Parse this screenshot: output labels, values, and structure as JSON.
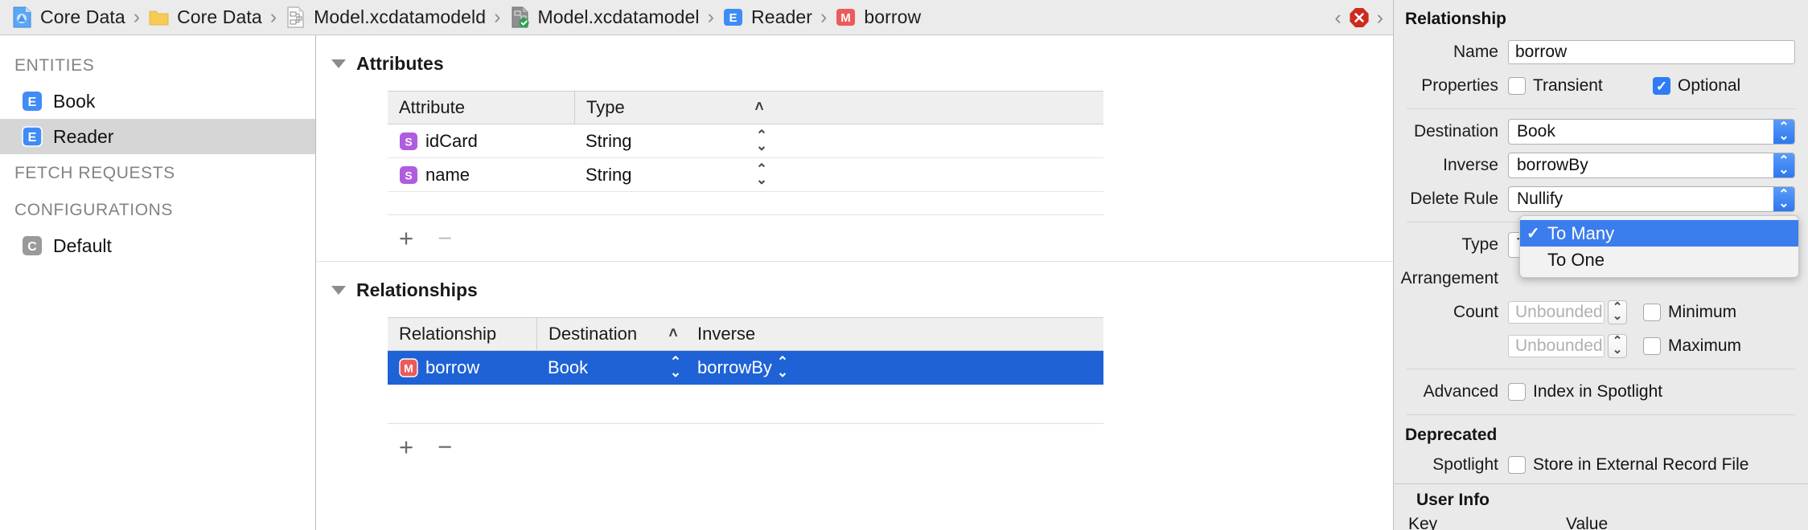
{
  "breadcrumb": {
    "items": [
      {
        "label": "Core Data",
        "icon": "xcode-project-icon"
      },
      {
        "label": "Core Data",
        "icon": "folder-icon"
      },
      {
        "label": "Model.xcdatamodeld",
        "icon": "xcdatamodeld-icon"
      },
      {
        "label": "Model.xcdatamodel",
        "icon": "xcdatamodel-current-icon"
      },
      {
        "label": "Reader",
        "icon": "entity-badge-icon"
      },
      {
        "label": "borrow",
        "icon": "relationship-badge-icon"
      }
    ],
    "separator": "›",
    "nav_back": "‹",
    "nav_forward": "›",
    "error_badge": "×"
  },
  "sidebar": {
    "groups": [
      {
        "title": "ENTITIES",
        "items": [
          {
            "label": "Book",
            "badge": "E",
            "badge_color": "#3f8cf6",
            "selected": false
          },
          {
            "label": "Reader",
            "badge": "E",
            "badge_color": "#3f8cf6",
            "selected": true
          }
        ]
      },
      {
        "title": "FETCH REQUESTS",
        "items": []
      },
      {
        "title": "CONFIGURATIONS",
        "items": [
          {
            "label": "Default",
            "badge": "C",
            "badge_color": "#9a9a9a",
            "selected": false
          }
        ]
      }
    ]
  },
  "editor": {
    "attributes": {
      "title": "Attributes",
      "columns": [
        "Attribute",
        "Type"
      ],
      "sort_indicator": "˄",
      "rows": [
        {
          "badge": "S",
          "name": "idCard",
          "type": "String"
        },
        {
          "badge": "S",
          "name": "name",
          "type": "String"
        }
      ],
      "add_label": "+",
      "remove_label": "−",
      "remove_enabled": false
    },
    "relationships": {
      "title": "Relationships",
      "columns": [
        "Relationship",
        "Destination",
        "Inverse"
      ],
      "sort_indicator": "˄",
      "rows": [
        {
          "badge": "M",
          "name": "borrow",
          "destination": "Book",
          "inverse": "borrowBy",
          "selected": true
        }
      ],
      "add_label": "+",
      "remove_label": "−",
      "remove_enabled": true
    }
  },
  "inspector": {
    "title": "Relationship",
    "name": {
      "label": "Name",
      "value": "borrow"
    },
    "properties": {
      "label": "Properties",
      "transient": {
        "label": "Transient",
        "checked": false
      },
      "optional": {
        "label": "Optional",
        "checked": true
      }
    },
    "destination": {
      "label": "Destination",
      "value": "Book"
    },
    "inverse": {
      "label": "Inverse",
      "value": "borrowBy"
    },
    "delete_rule": {
      "label": "Delete Rule",
      "value": "Nullify"
    },
    "type": {
      "label": "Type",
      "value": "To Many"
    },
    "arrangement": {
      "label": "Arrangement"
    },
    "count": {
      "label": "Count",
      "min_placeholder": "Unbounded",
      "max_placeholder": "Unbounded",
      "minimum": {
        "label": "Minimum",
        "checked": false
      },
      "maximum": {
        "label": "Maximum",
        "checked": false
      }
    },
    "advanced": {
      "label": "Advanced",
      "index_in_spotlight": {
        "label": "Index in Spotlight",
        "checked": false
      }
    },
    "deprecated": {
      "title": "Deprecated",
      "spotlight_label": "Spotlight",
      "store_external": {
        "label": "Store in External Record File",
        "checked": false
      }
    },
    "user_info": {
      "title": "User Info",
      "col_key": "Key",
      "col_value": "Value"
    }
  },
  "type_menu": {
    "items": [
      {
        "label": "To Many",
        "checked": true,
        "highlighted": true
      },
      {
        "label": "To One",
        "checked": false,
        "highlighted": false
      }
    ],
    "check_glyph": "✓"
  },
  "colors": {
    "selection_blue": "#1e62d6",
    "accent_blue": "#2f7cf6",
    "entity_badge": "#3f8cf6",
    "attribute_badge": "#b05ce0",
    "relationship_badge": "#ec5a5a",
    "error_red": "#cc2b1e"
  }
}
